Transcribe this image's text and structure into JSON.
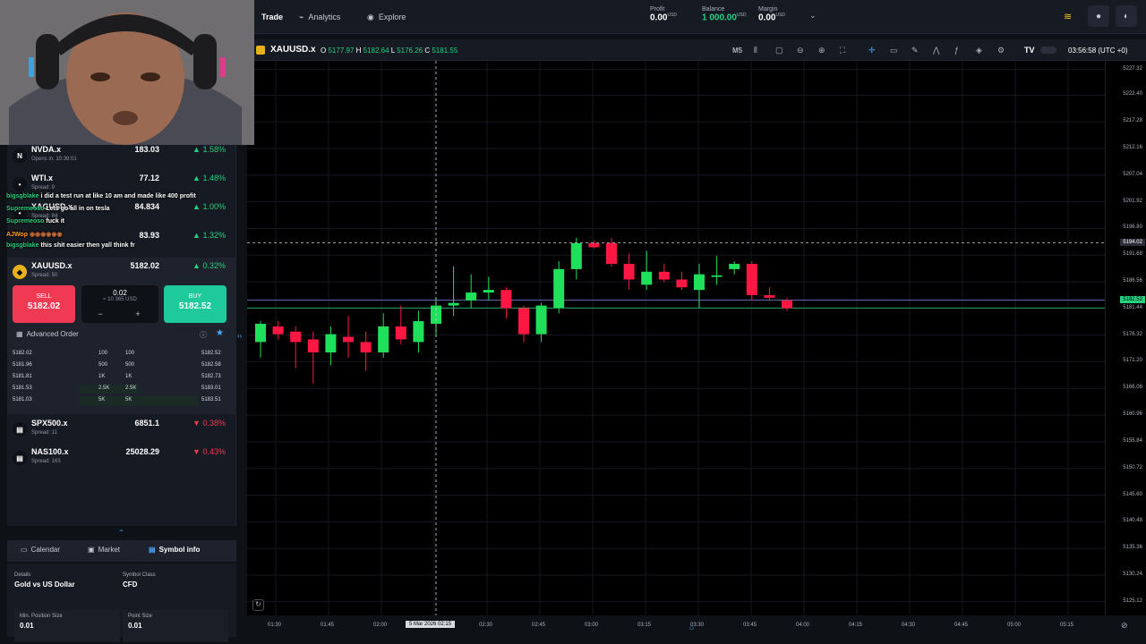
{
  "topbar": {
    "nav": [
      {
        "label": "Trade",
        "icon": "trade-icon",
        "active": true
      },
      {
        "label": "Analytics",
        "icon": "analytics-icon",
        "active": false
      },
      {
        "label": "Explore",
        "icon": "explore-icon",
        "active": false
      }
    ],
    "profit_label": "Profit",
    "profit_value": "0.00",
    "balance_label": "Balance",
    "balance_value": "1 000.00",
    "margin_label": "Margin",
    "margin_value": "0.00",
    "currency": "USD"
  },
  "chart_header": {
    "symbol": "XAUUSD.x",
    "o_label": "O",
    "o_value": "5177.97",
    "h_label": "H",
    "h_value": "5182.64",
    "l_label": "L",
    "l_value": "5176.26",
    "c_label": "C",
    "c_value": "5181.55",
    "timeframe": "M5",
    "clock": "03:56:58 (UTC +0)"
  },
  "watchlist": [
    {
      "symbol": "NVDA.x",
      "badge": "N",
      "sub": "Opens in: 10:38:01",
      "price": "183.03",
      "change": "1.58%",
      "dir": "up"
    },
    {
      "symbol": "WTI.x",
      "badge": "•",
      "sub": "Spread: 9",
      "price": "77.12",
      "change": "1.48%",
      "dir": "up"
    },
    {
      "symbol": "XAGUSD.x",
      "badge": "•",
      "sub": "Spread: 84",
      "price": "84.834",
      "change": "1.00%",
      "dir": "up"
    },
    {
      "symbol": "",
      "badge": "",
      "sub": "",
      "price": "83.93",
      "change": "1.32%",
      "dir": "up"
    }
  ],
  "selected": {
    "symbol": "XAUUSD.x",
    "sub": "Spread: 50",
    "price": "5182.02",
    "change": "0.32%",
    "sell_label": "SELL",
    "sell_price": "5182.02",
    "buy_label": "BUY",
    "buy_price": "5182.52",
    "qty": "0.02",
    "qty_usd": "≈ 10 365 USD",
    "minus": "−",
    "plus": "+",
    "advanced_label": "Advanced Order"
  },
  "orderbook": [
    {
      "bid": "5182.02",
      "bq": "100",
      "aq": "100",
      "ask": "5182.52",
      "depth": 0.0
    },
    {
      "bid": "5181.96",
      "bq": "500",
      "aq": "500",
      "ask": "5182.58",
      "depth": 0.0
    },
    {
      "bid": "5181.81",
      "bq": "1K",
      "aq": "1K",
      "ask": "5182.73",
      "depth": 0.0
    },
    {
      "bid": "5181.53",
      "bq": "2.5K",
      "aq": "2.5K",
      "ask": "5183.01",
      "depth": 0.5
    },
    {
      "bid": "5181.03",
      "bq": "5K",
      "aq": "5K",
      "ask": "5183.51",
      "depth": 1.0
    }
  ],
  "watchlist2": [
    {
      "symbol": "SPX500.x",
      "sub": "Spread: 11",
      "price": "6851.1",
      "change": "0.38%",
      "dir": "down"
    },
    {
      "symbol": "NAS100.x",
      "sub": "Spread: 163",
      "price": "25028.29",
      "change": "0.43%",
      "dir": "down"
    }
  ],
  "bottom_tabs": [
    {
      "label": "Calendar",
      "active": false
    },
    {
      "label": "Market",
      "active": false
    },
    {
      "label": "Symbol info",
      "active": true
    }
  ],
  "details": [
    {
      "label": "Details",
      "value": "Gold vs US Dollar"
    },
    {
      "label": "Symbol Class",
      "value": "CFD"
    },
    {
      "label": "Min. Position Size",
      "value": "0.01"
    },
    {
      "label": "Point Size",
      "value": "0.01"
    }
  ],
  "chat": [
    {
      "user": "bigsgblake",
      "user_color": "#25d17f",
      "msg": "i did a test run at like 10 am and made like 400 profit"
    },
    {
      "user": "Supremeoso",
      "user_color": "#25d17f",
      "msg": "Lets go all in on tesla"
    },
    {
      "user": "Supremeoso",
      "user_color": "#25d17f",
      "msg": "fuck it"
    },
    {
      "user": "AJWop",
      "user_color": "#ff9f1c",
      "msg": ""
    },
    {
      "user": "bigsgblake",
      "user_color": "#25d17f",
      "msg": "this shit easier then yall think fr"
    }
  ],
  "chart_data": {
    "type": "candlestick",
    "symbol": "XAUUSD.x",
    "timeframe": "M5",
    "ylim": [
      5122.5,
      5229.0
    ],
    "y_ticks": [
      "5227.32",
      "5222.40",
      "5217.28",
      "5212.16",
      "5207.04",
      "5201.92",
      "5196.80",
      "5191.68",
      "5186.56",
      "5181.44",
      "5176.32",
      "5171.20",
      "5166.08",
      "5160.96",
      "5155.84",
      "5150.72",
      "5145.60",
      "5140.48",
      "5135.36",
      "5130.24",
      "5125.12"
    ],
    "x_ticks": [
      "01:30",
      "01:45",
      "02:00",
      "02:15",
      "02:30",
      "02:45",
      "03:00",
      "03:15",
      "03:30",
      "03:45",
      "04:00",
      "04:15",
      "04:30",
      "04:45",
      "05:00",
      "05:15"
    ],
    "crosshair_time": "5 Mar 2026 02:15",
    "crosshair_price": "5194.02",
    "bid_line": 5181.55,
    "ask_line": "5182.52",
    "candles": [
      {
        "t": 0,
        "o": 5175.0,
        "h": 5179.0,
        "l": 5172.0,
        "c": 5178.5
      },
      {
        "t": 1,
        "o": 5178.0,
        "h": 5179.0,
        "l": 5175.5,
        "c": 5176.5
      },
      {
        "t": 2,
        "o": 5177.0,
        "h": 5178.0,
        "l": 5170.0,
        "c": 5175.0
      },
      {
        "t": 3,
        "o": 5175.5,
        "h": 5177.0,
        "l": 5167.0,
        "c": 5173.0
      },
      {
        "t": 4,
        "o": 5173.0,
        "h": 5178.0,
        "l": 5170.5,
        "c": 5176.5
      },
      {
        "t": 5,
        "o": 5176.0,
        "h": 5180.0,
        "l": 5172.0,
        "c": 5175.0
      },
      {
        "t": 6,
        "o": 5175.0,
        "h": 5177.0,
        "l": 5169.5,
        "c": 5173.0
      },
      {
        "t": 7,
        "o": 5173.0,
        "h": 5180.5,
        "l": 5172.0,
        "c": 5178.0
      },
      {
        "t": 8,
        "o": 5178.0,
        "h": 5182.0,
        "l": 5174.5,
        "c": 5175.5
      },
      {
        "t": 9,
        "o": 5175.0,
        "h": 5181.0,
        "l": 5173.0,
        "c": 5179.0
      },
      {
        "t": 10,
        "o": 5178.5,
        "h": 5183.5,
        "l": 5176.0,
        "c": 5182.0
      },
      {
        "t": 11,
        "o": 5182.0,
        "h": 5189.5,
        "l": 5180.0,
        "c": 5182.5
      },
      {
        "t": 12,
        "o": 5183.0,
        "h": 5188.0,
        "l": 5181.5,
        "c": 5184.5
      },
      {
        "t": 13,
        "o": 5184.5,
        "h": 5187.5,
        "l": 5183.0,
        "c": 5185.0
      },
      {
        "t": 14,
        "o": 5185.0,
        "h": 5185.5,
        "l": 5179.5,
        "c": 5181.5
      },
      {
        "t": 15,
        "o": 5181.5,
        "h": 5182.0,
        "l": 5175.0,
        "c": 5176.5
      },
      {
        "t": 16,
        "o": 5176.5,
        "h": 5182.5,
        "l": 5175.0,
        "c": 5182.0
      },
      {
        "t": 17,
        "o": 5181.5,
        "h": 5190.5,
        "l": 5180.5,
        "c": 5189.0
      },
      {
        "t": 18,
        "o": 5189.0,
        "h": 5195.0,
        "l": 5187.0,
        "c": 5194.0
      },
      {
        "t": 19,
        "o": 5194.0,
        "h": 5194.5,
        "l": 5193.0,
        "c": 5193.2
      },
      {
        "t": 20,
        "o": 5194.0,
        "h": 5195.0,
        "l": 5189.5,
        "c": 5190.0
      },
      {
        "t": 21,
        "o": 5190.0,
        "h": 5192.0,
        "l": 5185.0,
        "c": 5187.0
      },
      {
        "t": 22,
        "o": 5186.0,
        "h": 5192.5,
        "l": 5185.0,
        "c": 5188.5
      },
      {
        "t": 23,
        "o": 5188.5,
        "h": 5190.0,
        "l": 5186.5,
        "c": 5187.0
      },
      {
        "t": 24,
        "o": 5187.0,
        "h": 5188.5,
        "l": 5185.0,
        "c": 5185.5
      },
      {
        "t": 25,
        "o": 5185.0,
        "h": 5190.0,
        "l": 5181.5,
        "c": 5188.0
      },
      {
        "t": 26,
        "o": 5187.5,
        "h": 5191.5,
        "l": 5186.0,
        "c": 5187.8
      },
      {
        "t": 27,
        "o": 5189.0,
        "h": 5190.5,
        "l": 5188.0,
        "c": 5190.0
      },
      {
        "t": 28,
        "o": 5190.0,
        "h": 5190.5,
        "l": 5183.0,
        "c": 5184.0
      },
      {
        "t": 29,
        "o": 5184.0,
        "h": 5185.5,
        "l": 5183.0,
        "c": 5183.5
      },
      {
        "t": 30,
        "o": 5183.0,
        "h": 5183.5,
        "l": 5181.0,
        "c": 5181.5
      }
    ]
  }
}
